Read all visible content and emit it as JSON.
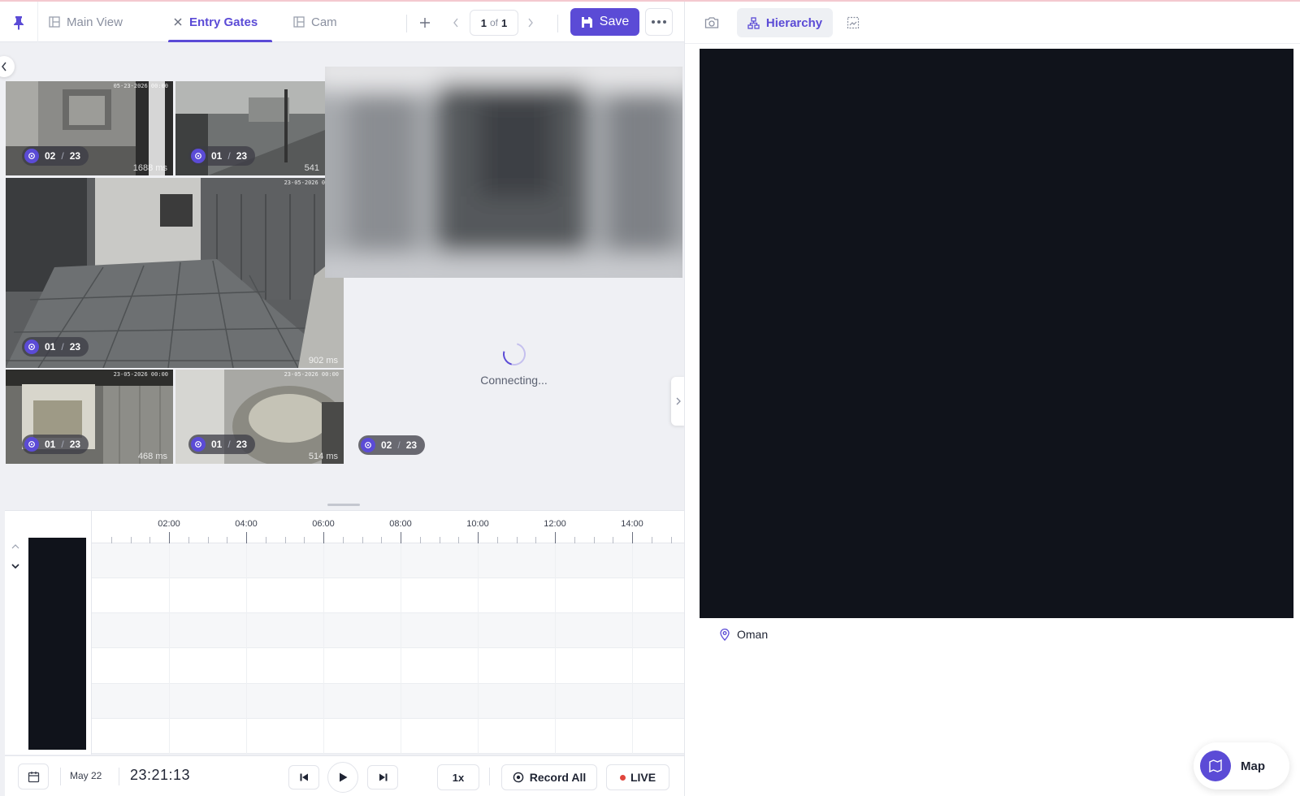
{
  "tabs": [
    {
      "label": "Main View",
      "icon": "layout-icon",
      "active": false
    },
    {
      "label": "Entry Gates",
      "icon": "close-icon",
      "active": true
    },
    {
      "label": "Cam",
      "icon": "layout-icon",
      "active": false
    }
  ],
  "pager": {
    "current": "1",
    "of": "of",
    "total": "1"
  },
  "toolbar": {
    "save_label": "Save"
  },
  "cameras": [
    {
      "badge_a": "02",
      "badge_b": "23",
      "latency": "1688 ms"
    },
    {
      "badge_a": "01",
      "badge_b": "23",
      "latency": "541"
    },
    {
      "badge_a": "01",
      "badge_b": "23",
      "latency": "902 ms"
    },
    {
      "badge_a": "01",
      "badge_b": "23",
      "latency": "468 ms"
    },
    {
      "badge_a": "01",
      "badge_b": "23",
      "latency": "514 ms"
    },
    {
      "badge_a": "02",
      "badge_b": "23"
    }
  ],
  "connecting_label": "Connecting...",
  "timeline": {
    "ticks": [
      "02:00",
      "04:00",
      "06:00",
      "08:00",
      "10:00",
      "12:00",
      "14:00"
    ]
  },
  "controls": {
    "date": "May 22",
    "time": "23:21:13",
    "speed": "1x",
    "record_all": "Record All",
    "live": "LIVE"
  },
  "right": {
    "hierarchy_label": "Hierarchy",
    "location": "Oman",
    "map_label": "Map"
  },
  "colors": {
    "accent": "#5b4bd6",
    "live_dot": "#e0453c",
    "dark_panel": "#10131b"
  }
}
